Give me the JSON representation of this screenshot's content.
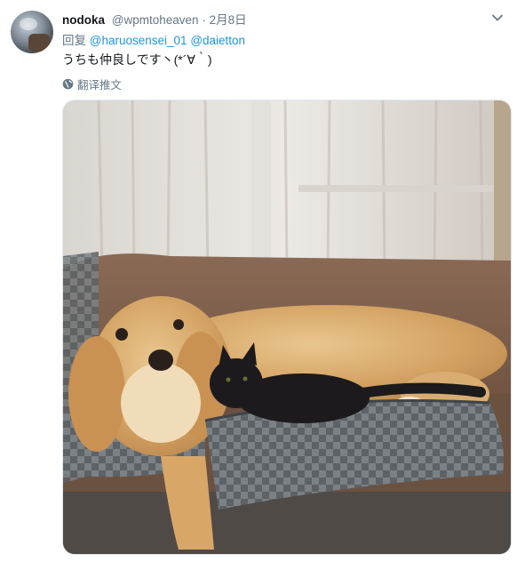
{
  "tweet": {
    "name": "nodoka",
    "handle": "@wpmtoheaven",
    "separator": "·",
    "date": "2月8日",
    "reply_prefix": "回复",
    "mentions": [
      "@haruosensei_01",
      "@daietton"
    ],
    "text": "うちも仲良しです丶(*´∀｀)",
    "translate_label": "翻译推文",
    "icons": {
      "more": "chevron-down-icon",
      "translate": "globe-icon"
    },
    "colors": {
      "link": "#1b95e0",
      "secondary": "#657786",
      "text": "#14171a"
    }
  }
}
